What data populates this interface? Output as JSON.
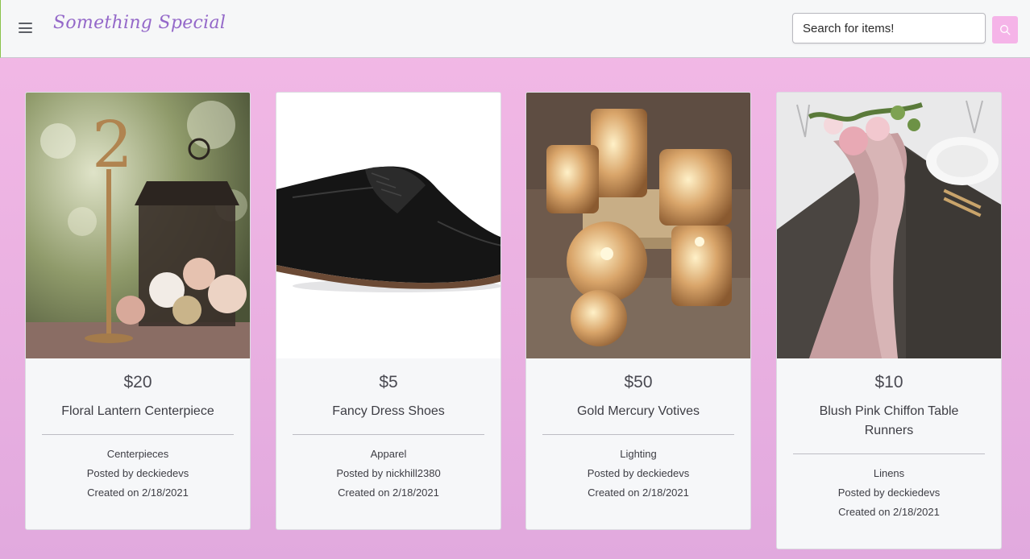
{
  "header": {
    "brand": "Something Special",
    "search_placeholder": "Search for items!"
  },
  "items": [
    {
      "price": "$20",
      "title": "Floral Lantern Centerpiece",
      "category": "Centerpieces",
      "posted_by": "Posted by deckiedevs",
      "created": "Created on 2/18/2021",
      "image": "lantern-centerpiece-photo"
    },
    {
      "price": "$5",
      "title": "Fancy Dress Shoes",
      "category": "Apparel",
      "posted_by": "Posted by nickhill2380",
      "created": "Created on 2/18/2021",
      "image": "dress-shoe-photo"
    },
    {
      "price": "$50",
      "title": "Gold Mercury Votives",
      "category": "Lighting",
      "posted_by": "Posted by deckiedevs",
      "created": "Created on 2/18/2021",
      "image": "gold-votives-photo"
    },
    {
      "price": "$10",
      "title": "Blush Pink Chiffon Table Runners",
      "category": "Linens",
      "posted_by": "Posted by deckiedevs",
      "created": "Created on 2/18/2021",
      "image": "table-runner-photo"
    }
  ],
  "colors": {
    "background": "#f3b9e6",
    "brand": "#9468c9",
    "search_button": "#f5b4e8"
  }
}
